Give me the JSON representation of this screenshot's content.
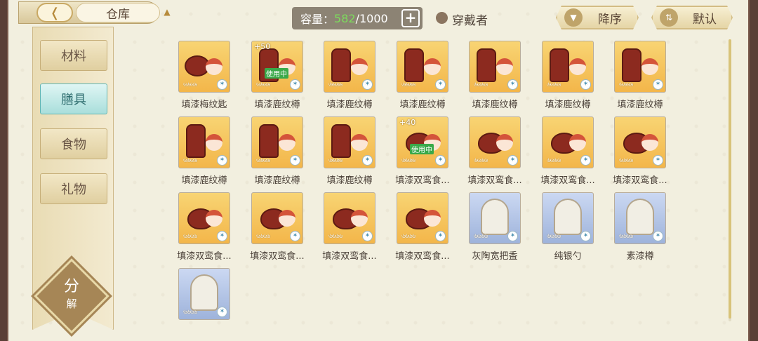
{
  "header": {
    "back_icon": "chevron-left-icon",
    "title": "仓库",
    "title_icon": "crown-icon",
    "capacity_label": "容量：",
    "capacity_current": "582",
    "capacity_max": "/1000",
    "add_capacity_icon": "plus-icon",
    "wearer_label": "穿戴者",
    "sort_order_label": "降序",
    "sort_mode_label": "默认"
  },
  "sidebar": {
    "tabs": [
      {
        "label": "材料",
        "active": false
      },
      {
        "label": "膳具",
        "active": true
      },
      {
        "label": "食物",
        "active": false
      },
      {
        "label": "礼物",
        "active": false
      }
    ],
    "decompose_a": "分",
    "decompose_b": "解"
  },
  "items": [
    {
      "name": "填漆梅纹匙",
      "art": "spoon",
      "bg": "gold",
      "plus": "",
      "inuse": false
    },
    {
      "name": "填漆鹿纹樽",
      "art": "jar",
      "bg": "gold",
      "plus": "+50",
      "inuse": true
    },
    {
      "name": "填漆鹿纹樽",
      "art": "jar",
      "bg": "gold",
      "plus": "",
      "inuse": false
    },
    {
      "name": "填漆鹿纹樽",
      "art": "jar",
      "bg": "gold",
      "plus": "",
      "inuse": false
    },
    {
      "name": "填漆鹿纹樽",
      "art": "jar",
      "bg": "gold",
      "plus": "",
      "inuse": false
    },
    {
      "name": "填漆鹿纹樽",
      "art": "jar",
      "bg": "gold",
      "plus": "",
      "inuse": false
    },
    {
      "name": "填漆鹿纹樽",
      "art": "jar",
      "bg": "gold",
      "plus": "",
      "inuse": false
    },
    {
      "name": "填漆鹿纹樽",
      "art": "jar",
      "bg": "gold",
      "plus": "",
      "inuse": false
    },
    {
      "name": "填漆鹿纹樽",
      "art": "jar",
      "bg": "gold",
      "plus": "",
      "inuse": false
    },
    {
      "name": "填漆鹿纹樽",
      "art": "jar",
      "bg": "gold",
      "plus": "",
      "inuse": false
    },
    {
      "name": "填漆双鸾食...",
      "art": "bowl",
      "bg": "gold",
      "plus": "+40",
      "inuse": true
    },
    {
      "name": "填漆双鸾食...",
      "art": "bowl",
      "bg": "gold",
      "plus": "",
      "inuse": false
    },
    {
      "name": "填漆双鸾食...",
      "art": "bowl",
      "bg": "gold",
      "plus": "",
      "inuse": false
    },
    {
      "name": "填漆双鸾食...",
      "art": "bowl",
      "bg": "gold",
      "plus": "",
      "inuse": false
    },
    {
      "name": "填漆双鸾食...",
      "art": "bowl",
      "bg": "gold",
      "plus": "",
      "inuse": false
    },
    {
      "name": "填漆双鸾食...",
      "art": "bowl",
      "bg": "gold",
      "plus": "",
      "inuse": false
    },
    {
      "name": "填漆双鸾食...",
      "art": "bowl",
      "bg": "gold",
      "plus": "",
      "inuse": false
    },
    {
      "name": "填漆双鸾食...",
      "art": "bowl",
      "bg": "gold",
      "plus": "",
      "inuse": false
    },
    {
      "name": "灰陶宽把盉",
      "art": "white",
      "bg": "blue",
      "plus": "",
      "inuse": false
    },
    {
      "name": "纯银勺",
      "art": "white",
      "bg": "blue",
      "plus": "",
      "inuse": false
    },
    {
      "name": "素漆樽",
      "art": "white",
      "bg": "blue",
      "plus": "",
      "inuse": false
    },
    {
      "name": "",
      "art": "white",
      "bg": "blue",
      "plus": "",
      "inuse": false
    }
  ],
  "item_star_text": "৬৬৬৬",
  "inuse_text": "使用中",
  "badge_icon": "fork-icon"
}
